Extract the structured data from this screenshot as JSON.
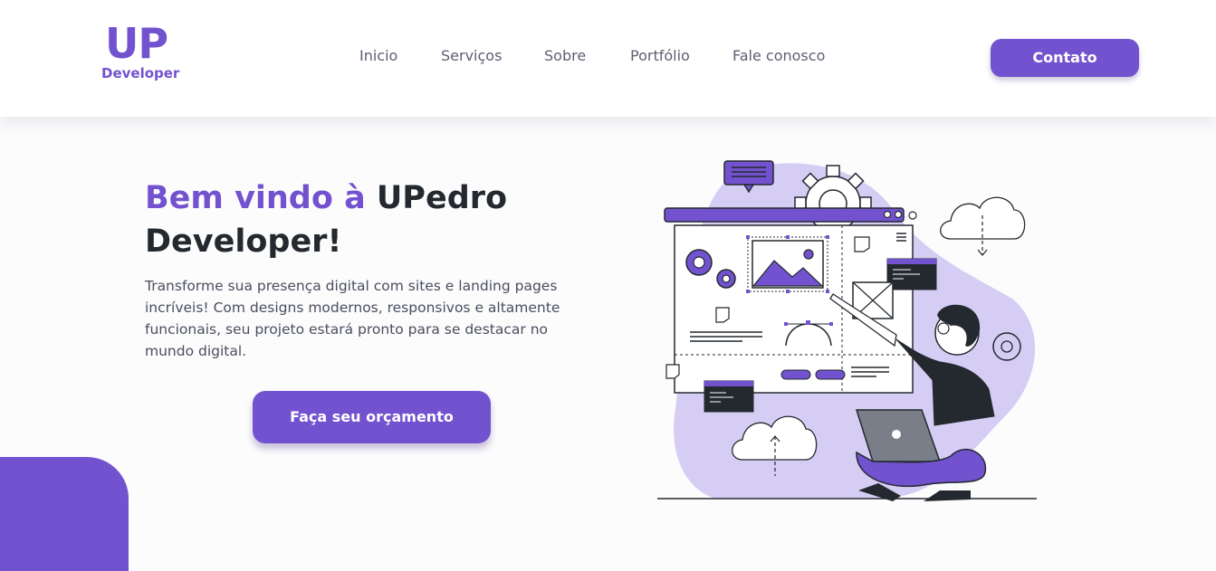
{
  "logo": {
    "top": "UP",
    "bottom": "Developer"
  },
  "nav": {
    "items": [
      "Inicio",
      "Serviços",
      "Sobre",
      "Portfólio",
      "Fale conosco"
    ]
  },
  "header": {
    "contact_label": "Contato"
  },
  "hero": {
    "title_accent": "Bem vindo à",
    "title_rest": "UPedro Developer!",
    "text": "Transforme sua presença digital com sites e landing pages incríveis! Com designs modernos, responsivos e altamente funcionais, seu projeto estará pronto para se destacar no mundo digital.",
    "cta_label": "Faça seu orçamento"
  },
  "illustration": {
    "icon": "developer-illustration"
  },
  "colors": {
    "accent": "#7352cf",
    "accent_light": "#d6cdf4",
    "text_dark": "#23292f",
    "text_muted": "#4a4e5e"
  }
}
